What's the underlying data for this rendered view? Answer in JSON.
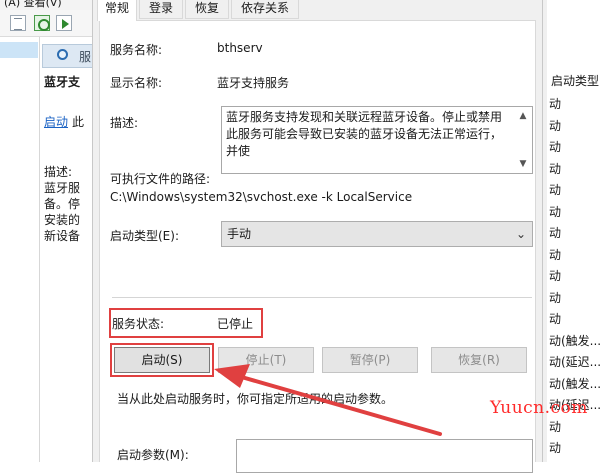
{
  "background": {
    "menu_fragment": "(A)  查看(V)",
    "header_label": "服",
    "description_panel": {
      "title": "蓝牙支",
      "start_link": "启动",
      "start_link_suffix": "此",
      "desc_label": "描述:",
      "desc_lines": [
        "蓝牙服",
        "备。停",
        "安装的",
        "新设备"
      ]
    },
    "list": {
      "column_header": "启动类型",
      "startup_types": [
        "动",
        "动",
        "动",
        "动",
        "动",
        "动",
        "动",
        "动",
        "动",
        "动",
        "动",
        "动(触发...",
        "动(延迟...",
        "动(触发...",
        "动(延迟...",
        "动",
        "动",
        "动"
      ]
    }
  },
  "dialog": {
    "tabs": [
      "常规",
      "登录",
      "恢复",
      "依存关系"
    ],
    "active_tab": "常规",
    "service_name_label": "服务名称:",
    "service_name": "bthserv",
    "display_name_label": "显示名称:",
    "display_name": "蓝牙支持服务",
    "description_label": "描述:",
    "description": "蓝牙服务支持发现和关联远程蓝牙设备。停止或禁用此服务可能会导致已安装的蓝牙设备无法正常运行，并使",
    "exe_path_label": "可执行文件的路径:",
    "exe_path": "C:\\Windows\\system32\\svchost.exe -k LocalService",
    "startup_type_label": "启动类型(E):",
    "startup_type": "手动",
    "status_label": "服务状态:",
    "status_value": "已停止",
    "buttons": {
      "start": "启动(S)",
      "stop": "停止(T)",
      "pause": "暂停(P)",
      "resume": "恢复(R)"
    },
    "hint": "当从此处启动服务时，你可指定所适用的启动参数。",
    "start_params_label": "启动参数(M):",
    "start_params_value": ""
  },
  "watermark": "Yuucn.com",
  "colors": {
    "highlight": "#e04040",
    "link": "#1a62c4",
    "watermark": "#ff2a2a"
  }
}
